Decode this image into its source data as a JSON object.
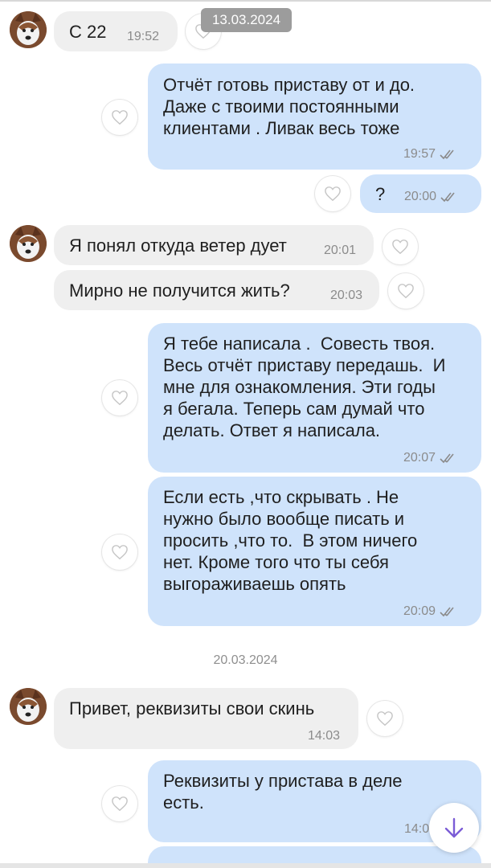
{
  "sticky_date": "13.03.2024",
  "date_separator": "20.03.2024",
  "messages": [
    {
      "text": "С 22",
      "time": "19:52"
    },
    {
      "text": "Отчёт готовь приставу от и до.\nДаже с твоими постоянными\nклиентами . Ливак весь тоже",
      "time": "19:57"
    },
    {
      "text": "?",
      "time": "20:00"
    },
    {
      "text": "Я понял откуда ветер дует",
      "time": "20:01"
    },
    {
      "text": "Мирно не получится жить?",
      "time": "20:03"
    },
    {
      "text": "Я тебе написала .  Совесть твоя.\nВесь отчёт приставу передашь.  И\nмне для ознакомления. Эти годы\nя бегала. Теперь сам думай что\nделать. Ответ я написала.",
      "time": "20:07"
    },
    {
      "text": "Если есть ,что скрывать . Не\nнужно было вообще писать и\nпросить ,что то.  В этом ничего\nнет. Кроме того что ты себя\nвыгораживаешь опять",
      "time": "20:09"
    },
    {
      "text": "Привет, реквизиты свои скинь",
      "time": "14:03"
    },
    {
      "text": "Реквизиты у пристава в деле\nесть.",
      "time": "14:0"
    }
  ],
  "icons": {
    "like": "heart-outline-icon",
    "read": "double-check-icon",
    "scroll": "arrow-down-icon",
    "avatar": "dog-avatar"
  },
  "colors": {
    "incoming": "#efefef",
    "outgoing": "#cfe3fb",
    "accent": "#7b5cd6"
  }
}
